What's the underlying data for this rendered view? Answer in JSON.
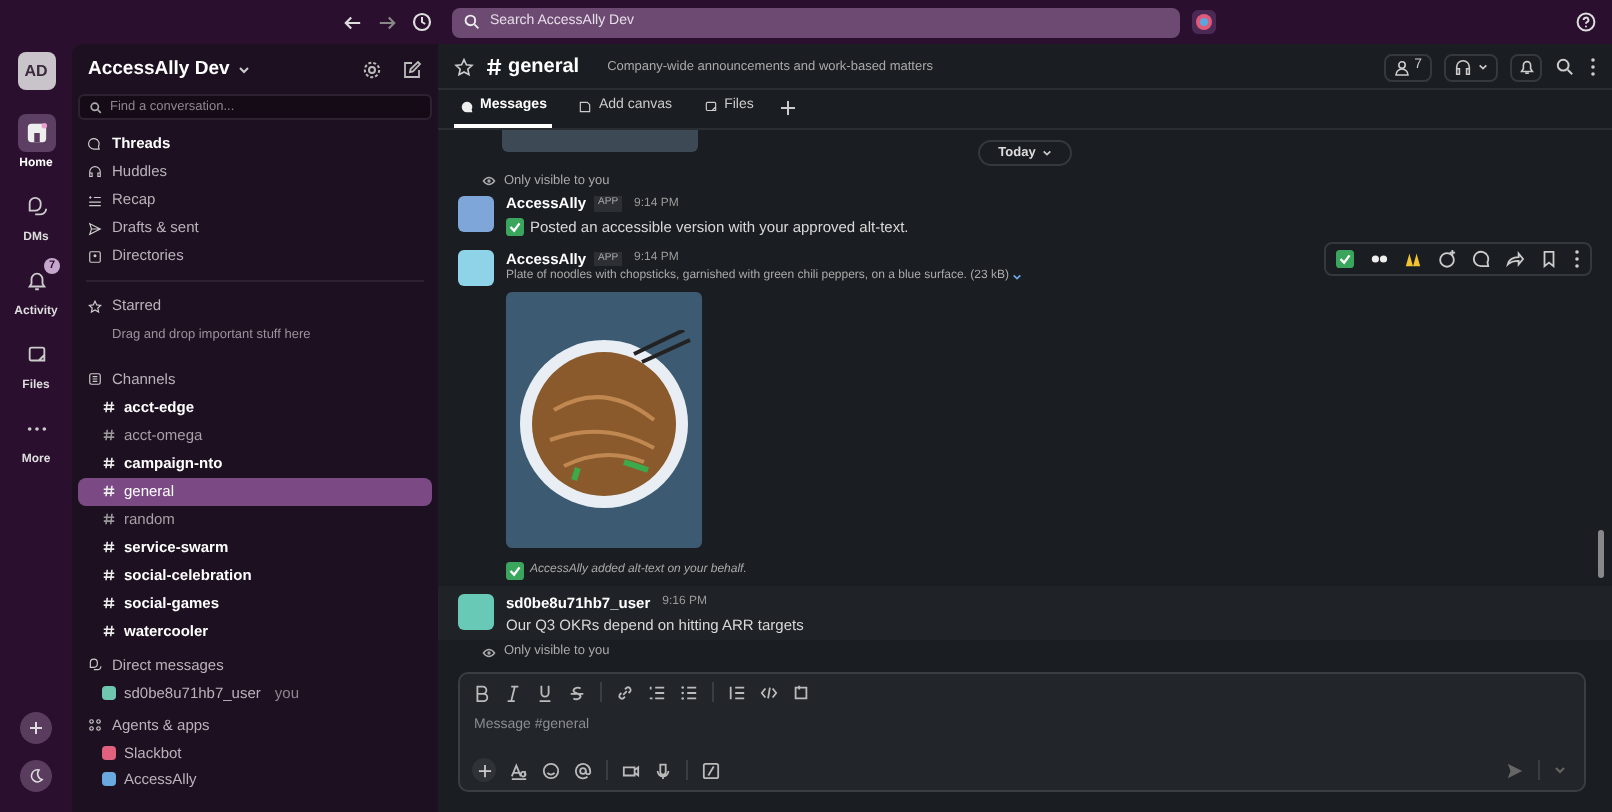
{
  "workspace": {
    "initials": "AD",
    "name": "AccessAlly Dev"
  },
  "search": {
    "placeholder": "Search AccessAlly Dev"
  },
  "rail": [
    {
      "label": "Home",
      "selected": true
    },
    {
      "label": "DMs",
      "selected": false
    },
    {
      "label": "Activity",
      "selected": false,
      "badge": "7"
    },
    {
      "label": "Files",
      "selected": false
    },
    {
      "label": "More",
      "selected": false
    }
  ],
  "sidebar": {
    "find_placeholder": "Find a conversation...",
    "nav": [
      {
        "label": "Threads",
        "unread": true
      },
      {
        "label": "Huddles",
        "unread": false
      },
      {
        "label": "Recap",
        "unread": false
      },
      {
        "label": "Drafts & sent",
        "unread": false
      },
      {
        "label": "Directories",
        "unread": false
      }
    ],
    "starred": {
      "header": "Starred",
      "hint": "Drag and drop important stuff here"
    },
    "channels_header": "Channels",
    "channels": [
      {
        "name": "acct-edge",
        "unread": true,
        "selected": false
      },
      {
        "name": "acct-omega",
        "unread": false,
        "selected": false
      },
      {
        "name": "campaign-nto",
        "unread": true,
        "selected": false
      },
      {
        "name": "general",
        "unread": false,
        "selected": true
      },
      {
        "name": "random",
        "unread": false,
        "selected": false
      },
      {
        "name": "service-swarm",
        "unread": true,
        "selected": false
      },
      {
        "name": "social-celebration",
        "unread": true,
        "selected": false
      },
      {
        "name": "social-games",
        "unread": true,
        "selected": false
      },
      {
        "name": "watercooler",
        "unread": true,
        "selected": false
      }
    ],
    "dm_header": "Direct messages",
    "dms": [
      {
        "name": "sd0be8u71hb7_user",
        "suffix": "you"
      }
    ],
    "apps_header": "Agents & apps",
    "apps": [
      {
        "name": "Slackbot"
      },
      {
        "name": "AccessAlly"
      }
    ]
  },
  "channel": {
    "name": "general",
    "description": "Company-wide announcements and work-based matters",
    "member_count": "7",
    "tabs": [
      {
        "label": "Messages",
        "selected": true
      },
      {
        "label": "Add canvas",
        "selected": false
      },
      {
        "label": "Files",
        "selected": false
      }
    ]
  },
  "date_divider": "Today",
  "messages": [
    {
      "kind": "ephemeral",
      "text": "Only visible to you"
    },
    {
      "kind": "message",
      "author": "AccessAlly",
      "badge": "APP",
      "time": "9:14 PM",
      "text": "Posted an accessible version with your approved alt-text.",
      "check": true
    },
    {
      "kind": "image",
      "author": "AccessAlly",
      "badge": "APP",
      "time": "9:14 PM",
      "text": "Plate of noodles with chopsticks, garnished with green chili peppers, on a blue surface. (23 kB)",
      "note": "AccessAlly added alt-text on your behalf.",
      "hovered": true
    },
    {
      "kind": "message",
      "author": "sd0be8u71hb7_user",
      "time": "9:16 PM",
      "text": "Our Q3 OKRs depend on hitting ARR targets",
      "check": false
    },
    {
      "kind": "ephemeral",
      "text": "Only visible to you"
    }
  ],
  "composer": {
    "placeholder": "Message #general"
  }
}
